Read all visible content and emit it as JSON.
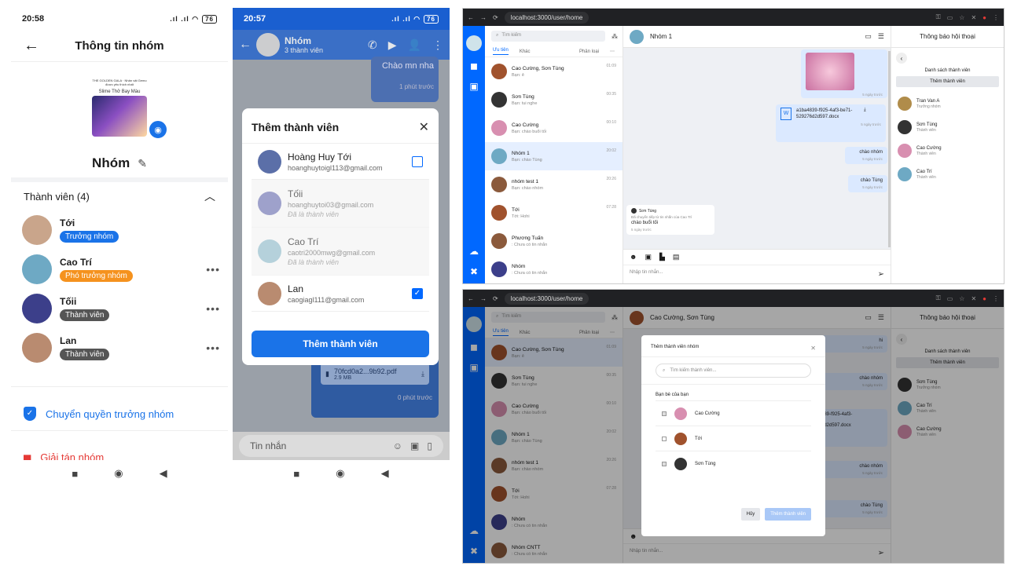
{
  "phone1": {
    "status_time": "20:58",
    "status_right": ".ıl .ıl ",
    "battery": "76",
    "title": "Thông tin nhóm",
    "group_image_caption": "Slime Thở Bay Màu",
    "group_image_text": "THE GOLDEN GALA · Nhân vật Gemo được yêu thích nhất",
    "group_name": "Nhóm",
    "members_header": "Thành viên (4)",
    "members": [
      {
        "name": "Tới",
        "role": "Trưởng nhóm",
        "role_color": "#1a73e8",
        "avatar_color": "#c9a58b",
        "has_menu": false
      },
      {
        "name": "Cao Trí",
        "role": "Phó trưởng nhóm",
        "role_color": "#f5921e",
        "avatar_color": "#6ea9c4",
        "has_menu": true
      },
      {
        "name": "Tốii",
        "role": "Thành viên",
        "role_color": "#555555",
        "avatar_color": "#3c3f8a",
        "has_menu": true
      },
      {
        "name": "Lan",
        "role": "Thành viên",
        "role_color": "#555555",
        "avatar_color": "#b98b70",
        "has_menu": true
      }
    ],
    "transfer_label": "Chuyển quyền trưởng nhóm",
    "dissolve_label": "Giải tán nhóm"
  },
  "phone2": {
    "status_time": "20:57",
    "status_right": ".ıl .ıl ",
    "battery": "76",
    "group_name": "Nhóm",
    "group_sub": "3 thành viên",
    "bubble_text": "Chào mn nha",
    "bubble_time": "1 phút trước",
    "file_name": "70fcd0a2...9b92.pdf",
    "file_size": "2.9 MB",
    "file_time": "0 phút trước",
    "modal_title": "Thêm thành viên",
    "candidates": [
      {
        "name": "Hoàng Huy Tới",
        "email": "hoanghuytoigl113@gmail.com",
        "note": "",
        "state": "unchecked",
        "avatar_color": "#5b6fa8"
      },
      {
        "name": "Tốii",
        "email": "hoanghuytoi03@gmail.com",
        "note": "Đã là thành viên",
        "state": "member",
        "avatar_color": "#6b6fb0"
      },
      {
        "name": "Cao Trí",
        "email": "caotri2000mwg@gmail.com",
        "note": "Đã là thành viên",
        "state": "member",
        "avatar_color": "#8fb9c8"
      },
      {
        "name": "Lan",
        "email": "caogiagl111@gmail.com",
        "note": "",
        "state": "checked",
        "avatar_color": "#b98b70"
      }
    ],
    "submit_label": "Thêm thành viên",
    "composer_placeholder": "Tin nhắn"
  },
  "web1": {
    "url": "localhost:3000/user/home",
    "search_placeholder": "Tìm kiếm",
    "tab_priority": "Ưu tiên",
    "tab_other": "Khác",
    "tab_classify": "Phân loại",
    "conversations": [
      {
        "name": "Cao Cường, Sơn Tùng",
        "preview": "Bạn: ê",
        "time": "01:09",
        "color": "#a0522d"
      },
      {
        "name": "Sơn Tùng",
        "preview": "Bạn: tui nghe",
        "time": "00:35",
        "color": "#333333"
      },
      {
        "name": "Cao Cường",
        "preview": "Bạn: chào buổi tối",
        "time": "00:10",
        "color": "#d88fb0"
      },
      {
        "name": "Nhóm 1",
        "preview": "Bạn: chào Tùng",
        "time": "20:02",
        "color": "#6ea9c4"
      },
      {
        "name": "nhóm test 1",
        "preview": "Bạn: chào nhóm",
        "time": "20:26",
        "color": "#8b5a3c"
      },
      {
        "name": "Tới",
        "preview": "Tới: Hohi",
        "time": "07:28",
        "color": "#a0522d"
      },
      {
        "name": "Phương Tuấn",
        "preview": ": Chưa có tin nhắn",
        "time": "",
        "color": "#8b5a3c"
      },
      {
        "name": "Nhóm",
        "preview": ": Chưa có tin nhắn",
        "time": "",
        "color": "#3c3f8a"
      }
    ],
    "chat_title": "Nhóm 1",
    "messages": [
      {
        "text": "a1ba4839-f925-4af3-be71-529276d2d597.docx",
        "time": "5 ngày trước"
      },
      {
        "text": "chào nhóm",
        "time": "5 ngày trước"
      },
      {
        "text": "chào Tùng",
        "time": "5 ngày trước"
      }
    ],
    "image_time": "5 ngày trước",
    "incoming_sender": "Sơn Tùng",
    "incoming_forward": "Đã chuyển tiếp từ tin nhắn của Cao Trí",
    "incoming_text": "chào buổi tối",
    "incoming_time": "5 ngày trước",
    "composer_placeholder": "Nhập tin nhắn...",
    "info_title": "Thông báo hội thoại",
    "members_title": "Danh sách thành viên",
    "add_member_label": "Thêm thành viên",
    "members": [
      {
        "name": "Tran Van A",
        "role": "Trưởng nhóm",
        "color": "#b08c4a"
      },
      {
        "name": "Sơn Tùng",
        "role": "Thành viên",
        "color": "#333333"
      },
      {
        "name": "Cao Cường",
        "role": "Thành viên",
        "color": "#d88fb0"
      },
      {
        "name": "Cao Trí",
        "role": "Thành viên",
        "color": "#6ea9c4"
      }
    ]
  },
  "web2": {
    "url": "localhost:3000/user/home",
    "search_placeholder": "Tìm kiếm",
    "tab_priority": "Ưu tiên",
    "tab_other": "Khác",
    "tab_classify": "Phân loại",
    "conversations": [
      {
        "name": "Cao Cường, Sơn Tùng",
        "preview": "Bạn: ê",
        "time": "01:09",
        "color": "#a0522d"
      },
      {
        "name": "Sơn Tùng",
        "preview": "Bạn: tui nghe",
        "time": "00:35",
        "color": "#333333"
      },
      {
        "name": "Cao Cường",
        "preview": "Bạn: chào buổi tối",
        "time": "00:10",
        "color": "#d88fb0"
      },
      {
        "name": "Nhóm 1",
        "preview": "Bạn: chào Tùng",
        "time": "20:02",
        "color": "#6ea9c4"
      },
      {
        "name": "nhóm test 1",
        "preview": "Bạn: chào nhóm",
        "time": "20:26",
        "color": "#8b5a3c"
      },
      {
        "name": "Tới",
        "preview": "Tới: Hohi",
        "time": "07:28",
        "color": "#a0522d"
      },
      {
        "name": "Nhóm",
        "preview": ": Chưa có tin nhắn",
        "time": "",
        "color": "#3c3f8a"
      },
      {
        "name": "Nhóm CNTT",
        "preview": ": Chưa có tin nhắn",
        "time": "",
        "color": "#8b5a3c"
      }
    ],
    "chat_title": "Cao Cường, Sơn Tùng",
    "bg_messages": [
      "hi",
      "chào nhóm",
      "chào nhóm",
      "chào Tùng"
    ],
    "bg_file": "6d2d597.docx",
    "bg_file2": "839-f925-4af3-",
    "bg_time": "5 ngày trước",
    "composer_placeholder": "Nhập tin nhắn...",
    "modal_title": "Thêm thành viên nhóm",
    "modal_search": "Tìm kiếm thành viên...",
    "friends_label": "Bạn bè của bạn",
    "friends": [
      {
        "name": "Cao Cường",
        "color": "#d88fb0",
        "disabled": true
      },
      {
        "name": "Tới",
        "color": "#a0522d",
        "disabled": false
      },
      {
        "name": "Sơn Tùng",
        "color": "#333333",
        "disabled": true
      }
    ],
    "cancel_label": "Hủy",
    "confirm_label": "Thêm thành viên",
    "info_title": "Thông báo hội thoại",
    "members_title": "Danh sách thành viên",
    "add_member_label": "Thêm thành viên",
    "members": [
      {
        "name": "Sơn Tùng",
        "role": "Trưởng nhóm",
        "color": "#333333"
      },
      {
        "name": "Cao Trí",
        "role": "Thành viên",
        "color": "#6ea9c4"
      },
      {
        "name": "Cao Cường",
        "role": "Thành viên",
        "color": "#d88fb0"
      }
    ]
  }
}
